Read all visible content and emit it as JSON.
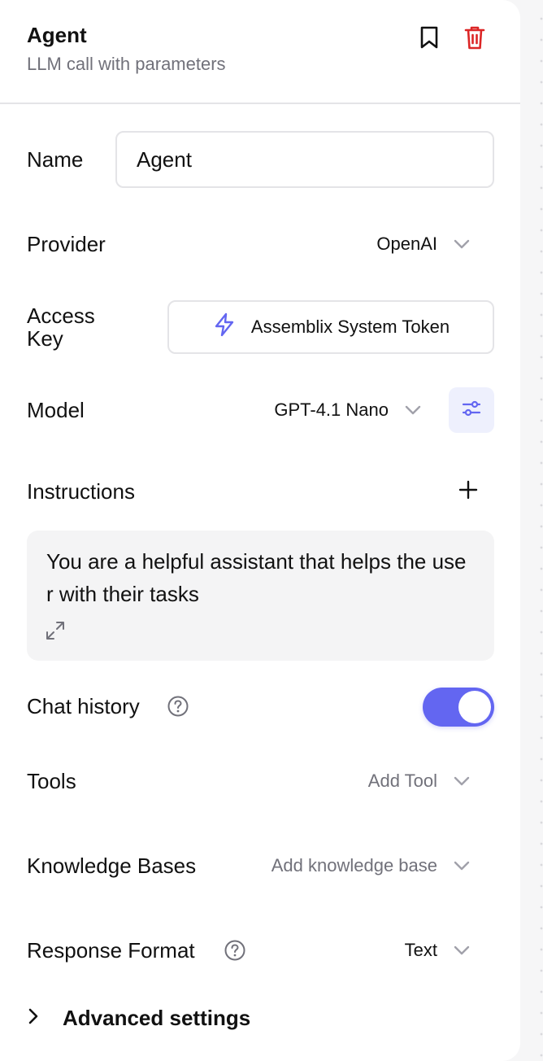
{
  "header": {
    "title": "Agent",
    "subtitle": "LLM call with parameters",
    "icons": [
      "bookmark-icon",
      "trash-icon"
    ],
    "trash_color": "#dc2626"
  },
  "fields": {
    "name_label": "Name",
    "name_value": "Agent",
    "provider_label": "Provider",
    "provider_value": "OpenAI",
    "access_key_label_line1": "Access",
    "access_key_label_line2": "Key",
    "access_key_value": "Assemblix System Token",
    "model_label": "Model",
    "model_value": "GPT-4.1 Nano",
    "instructions_label": "Instructions",
    "instructions_text": "You are a helpful assistant that helps the user with their tasks",
    "chat_history_label": "Chat history",
    "chat_history_enabled": true,
    "tools_label": "Tools",
    "tools_placeholder": "Add Tool",
    "knowledge_label": "Knowledge Bases",
    "knowledge_placeholder": "Add knowledge base",
    "response_format_label": "Response Format",
    "response_format_value": "Text",
    "advanced_label": "Advanced settings"
  },
  "colors": {
    "accent": "#6366f1",
    "accent_light": "#eef0fd",
    "muted_text": "#71717a"
  }
}
